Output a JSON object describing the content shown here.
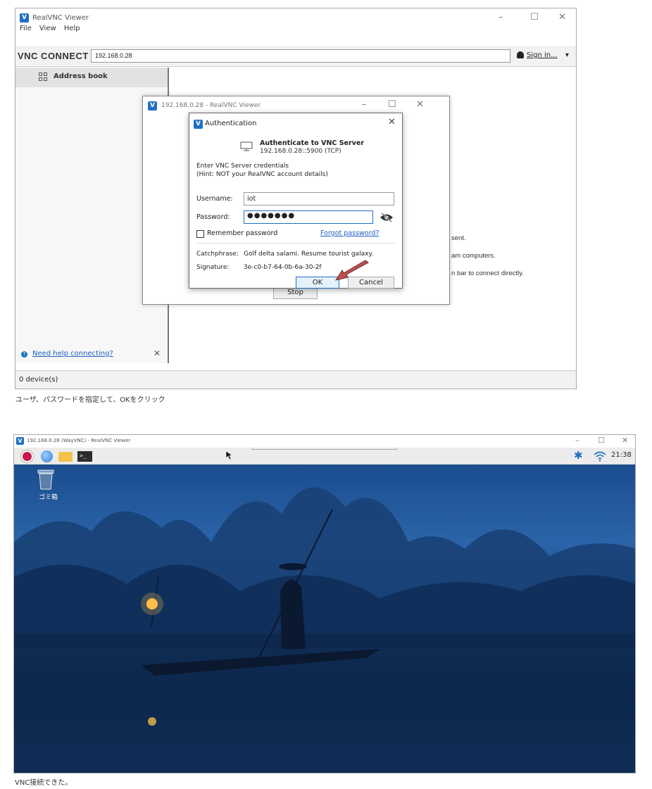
{
  "vnc_viewer": {
    "window_title": "RealVNC Viewer",
    "app_icon_glyph": "V",
    "menu": [
      "File",
      "View",
      "Help"
    ],
    "window_controls": {
      "minimize": "–",
      "maximize": "☐",
      "close": "✕"
    },
    "brand": "VNC CONNECT",
    "address_value": "192.168.0.28",
    "sign_in_label": "Sign in...",
    "dropdown_glyph": "▾",
    "sidebar": {
      "address_book_label": "Address book",
      "help_link": "Need help connecting?",
      "help_close": "✕"
    },
    "status": "0 device(s)",
    "background_text": [
      "sent.",
      "am computers.",
      "n bar to connect directly."
    ],
    "inner_window": {
      "title": "192.168.0.28 - RealVNC Viewer",
      "controls": {
        "minimize": "–",
        "maximize": "☐",
        "close": "✕"
      },
      "stop_label": "Stop"
    },
    "auth_dialog": {
      "title": "Authentication",
      "close": "✕",
      "heading": "Authenticate to VNC Server",
      "subheading": "192.168.0.28::5900 (TCP)",
      "instructions_line1": "Enter VNC Server credentials",
      "instructions_line2": "(Hint: NOT your RealVNC account details)",
      "username_label": "Username:",
      "username_value": "iot",
      "password_label": "Password:",
      "password_value": "●●●●●●●",
      "remember_label": "Remember password",
      "forgot_label": "Forgot password?",
      "catchphrase_label": "Catchphrase:",
      "catchphrase_value": "Golf delta salami. Resume tourist galaxy.",
      "signature_label": "Signature:",
      "signature_value": "3e-c0-b7-64-0b-6a-30-2f",
      "ok_label": "OK",
      "cancel_label": "Cancel"
    },
    "arrow_color": "#c0504d"
  },
  "caption1": "ユーザ、パスワードを指定して、OKをクリック",
  "desktop_window": {
    "title": "192.168.0.28 (WayVNC) - RealVNC Viewer",
    "controls": {
      "minimize": "–",
      "maximize": "☐",
      "close": "✕"
    },
    "clock": "21:38",
    "trash_label": "ゴミ箱",
    "bluetooth_glyph": "✱",
    "terminal_glyph": ">_"
  },
  "caption2": "VNC接続できた。"
}
